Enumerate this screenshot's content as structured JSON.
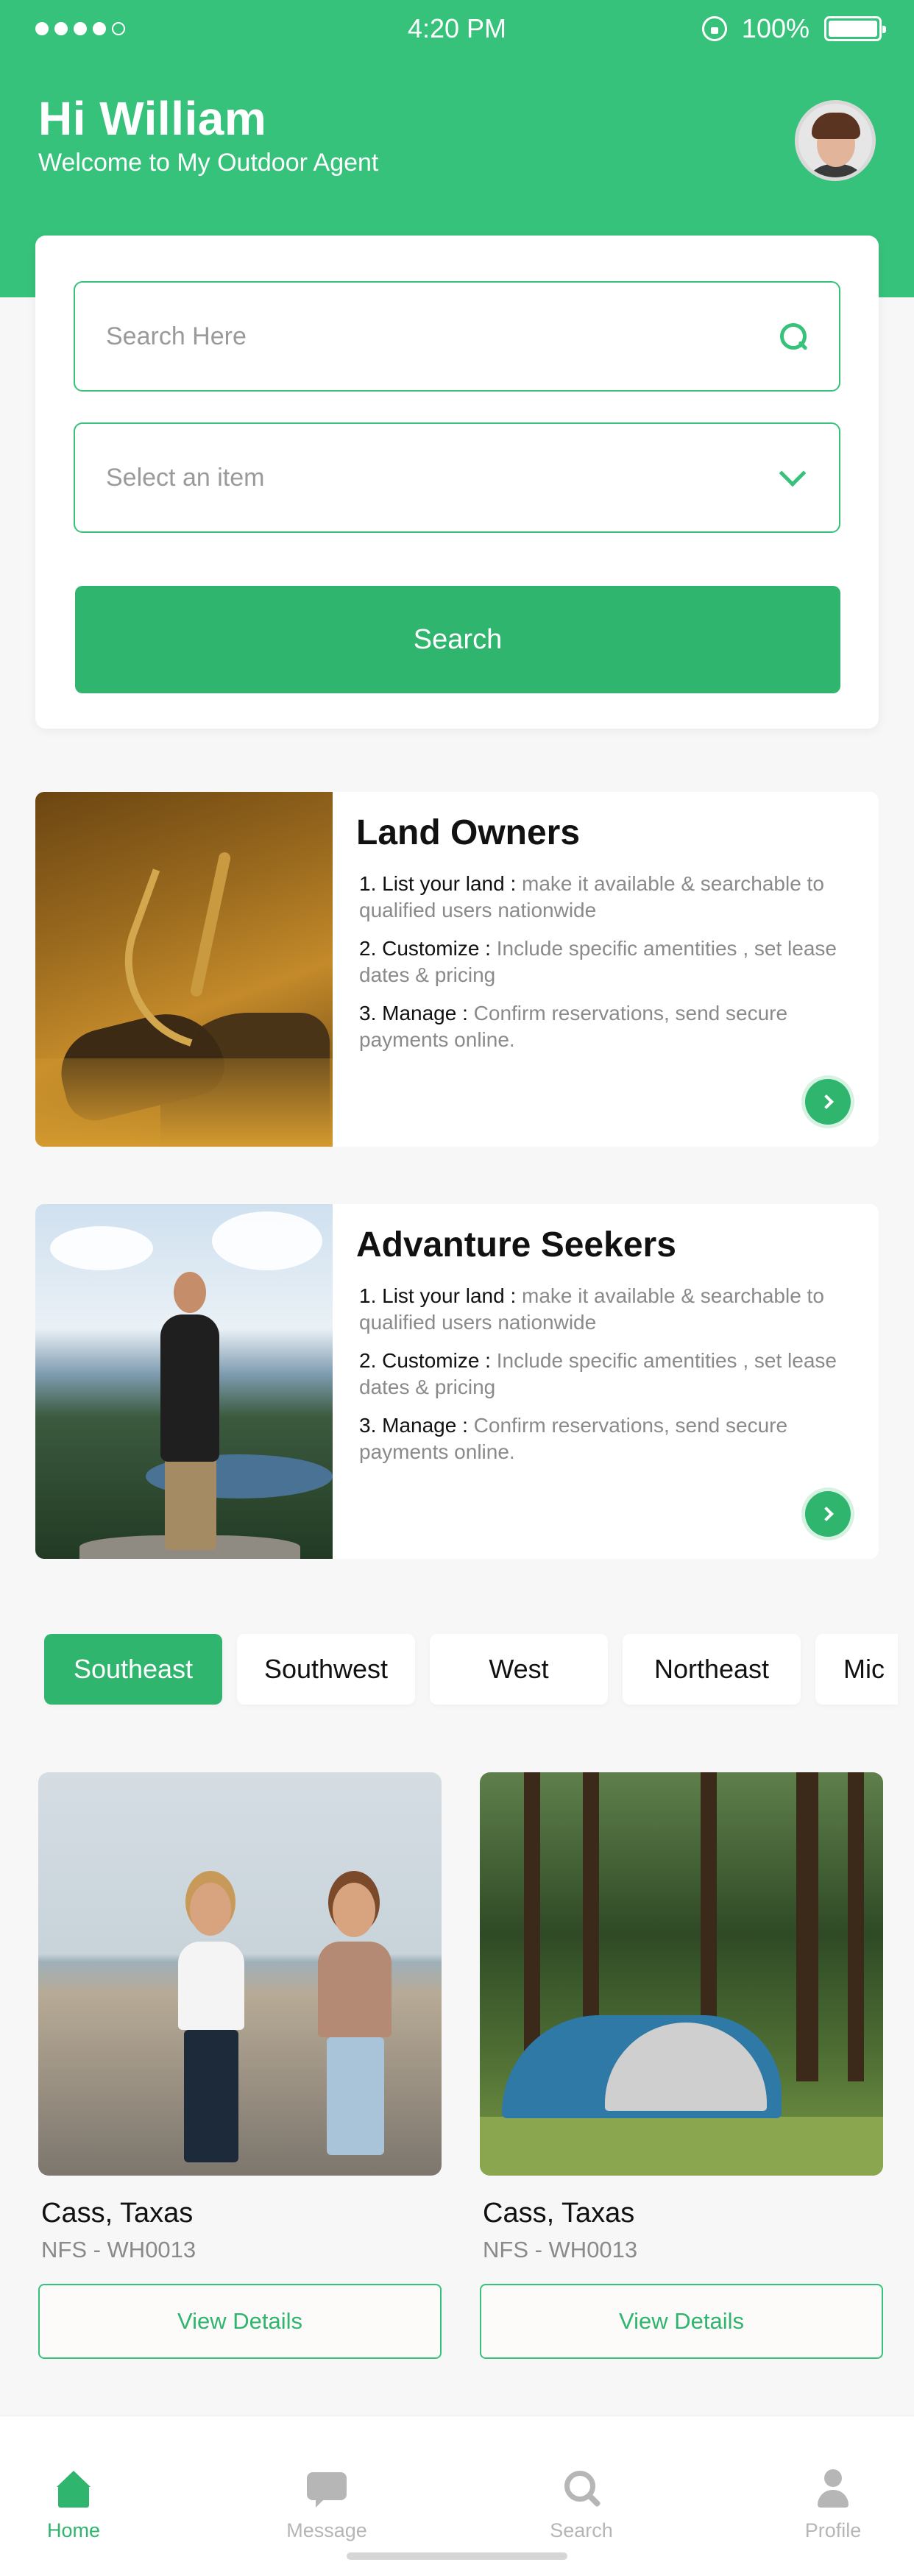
{
  "status_bar": {
    "signal": "●●●●○",
    "time": "4:20 PM",
    "battery": "100%"
  },
  "header": {
    "greeting": "Hi William",
    "subtitle": "Welcome to My Outdoor Agent"
  },
  "search": {
    "placeholder": "Search Here",
    "select_placeholder": "Select an item",
    "button_label": "Search"
  },
  "info_cards": [
    {
      "title": "Land Owners",
      "steps": [
        {
          "label": "1. List your land :",
          "text": "make it available & searchable to qualified users nationwide"
        },
        {
          "label": "2. Customize :",
          "text": "Include specific amentities , set lease dates & pricing"
        },
        {
          "label": "3. Manage :",
          "text": "Confirm reservations, send secure payments online."
        }
      ]
    },
    {
      "title": "Advanture Seekers",
      "steps": [
        {
          "label": "1. List your land :",
          "text": "make it available & searchable to qualified users nationwide"
        },
        {
          "label": "2. Customize :",
          "text": "Include specific amentities , set lease dates & pricing"
        },
        {
          "label": "3. Manage :",
          "text": "Confirm reservations, send secure payments online."
        }
      ]
    }
  ],
  "regions": [
    "Southeast",
    "Southwest",
    "West",
    "Northeast",
    "Mic"
  ],
  "active_region": "Southeast",
  "listings": [
    {
      "name": "Cass, Taxas",
      "code": "NFS - WH0013",
      "button": "View Details"
    },
    {
      "name": "Cass, Taxas",
      "code": "NFS - WH0013",
      "button": "View Details"
    }
  ],
  "tabbar": {
    "items": [
      {
        "label": "Home",
        "icon": "home-icon",
        "active": true
      },
      {
        "label": "Message",
        "icon": "message-icon",
        "active": false
      },
      {
        "label": "Search",
        "icon": "search-icon",
        "active": false
      },
      {
        "label": "Profile",
        "icon": "profile-icon",
        "active": false
      }
    ]
  },
  "colors": {
    "brand_green": "#37c27b",
    "button_green": "#2fb56d",
    "background": "#f7f7f7"
  }
}
